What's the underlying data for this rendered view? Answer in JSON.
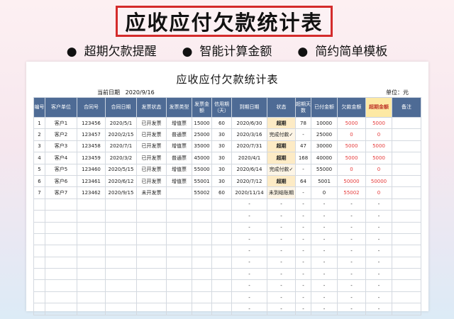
{
  "banner_title": "应收应付欠款统计表",
  "features": [
    "超期欠款提醒",
    "智能计算金额",
    "简约简单模板"
  ],
  "bullet": "●",
  "sheet": {
    "title": "应收应付欠款统计表",
    "current_date_label": "当前日期",
    "current_date": "2020/9/16",
    "unit": "单位：元",
    "headers": [
      "编号",
      "客户单位",
      "合同号",
      "合同日期",
      "发票状态",
      "发票类型",
      "发票金额",
      "信用期（天）",
      "到期日期",
      "状态",
      "超期天数",
      "已付金额",
      "欠款金额",
      "超期金额",
      "备注"
    ],
    "rows": [
      [
        "1",
        "客户1",
        "123456",
        "2020/5/1",
        "已开发票",
        "增值票",
        "15000",
        "60",
        "2020/6/30",
        "超期",
        "78",
        "10000",
        "5000",
        "5000",
        ""
      ],
      [
        "2",
        "客户2",
        "123457",
        "2020/2/15",
        "已开发票",
        "普通票",
        "25000",
        "30",
        "2020/3/16",
        "完成付款✓",
        "-",
        "25000",
        "0",
        "0",
        ""
      ],
      [
        "3",
        "客户3",
        "123458",
        "2020/7/1",
        "已开发票",
        "增值票",
        "35000",
        "30",
        "2020/7/31",
        "超期",
        "47",
        "30000",
        "5000",
        "5000",
        ""
      ],
      [
        "4",
        "客户4",
        "123459",
        "2020/3/2",
        "已开发票",
        "普通票",
        "45000",
        "30",
        "2020/4/1",
        "超期",
        "168",
        "40000",
        "5000",
        "5000",
        ""
      ],
      [
        "5",
        "客户5",
        "123460",
        "2020/5/15",
        "已开发票",
        "增值票",
        "55000",
        "30",
        "2020/6/14",
        "完成付款✓",
        "-",
        "55000",
        "0",
        "0",
        ""
      ],
      [
        "6",
        "客户6",
        "123461",
        "2020/6/12",
        "已开发票",
        "增值票",
        "55001",
        "30",
        "2020/7/12",
        "超期",
        "64",
        "5001",
        "50000",
        "50000",
        ""
      ],
      [
        "7",
        "客户7",
        "123462",
        "2020/9/15",
        "未开发票",
        "",
        "55002",
        "60",
        "2020/11/14",
        "未到结账期",
        "-",
        "0",
        "55002",
        "0",
        ""
      ]
    ],
    "empty_row": [
      "",
      "",
      "",
      "",
      "",
      "",
      "",
      "",
      "-",
      "-",
      "-",
      "-",
      "-",
      "-",
      ""
    ],
    "empty_row_count": 10
  }
}
